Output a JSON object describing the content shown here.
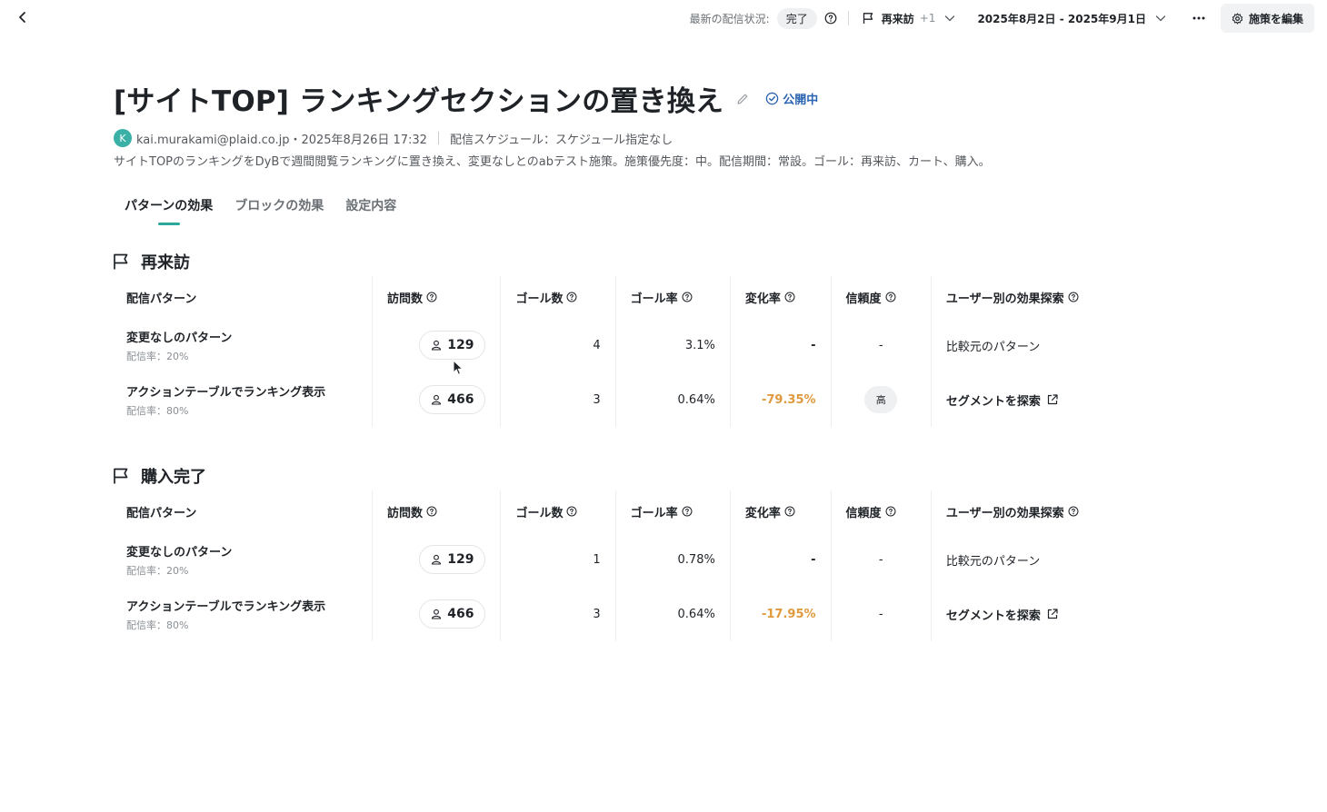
{
  "topbar": {
    "status_label": "最新の配信状況:",
    "status_value": "完了",
    "goal_label": "再来訪",
    "goal_extra": "+1",
    "date_range": "2025年8月2日 - 2025年9月1日",
    "edit_label": "施策を編集"
  },
  "header": {
    "title": "[サイトTOP] ランキングセクションの置き換え",
    "status": "公開中",
    "avatar_initial": "K",
    "author": "kai.murakami@plaid.co.jp・2025年8月26日 17:32",
    "schedule": "配信スケジュール：スケジュール指定なし",
    "description": "サイトTOPのランキングをDyBで週間閲覧ランキングに置き換え、変更なしとのabテスト施策。施策優先度：中。配信期間：常設。ゴール：再来訪、カート、購入。"
  },
  "tabs": [
    {
      "label": "パターンの効果",
      "active": true
    },
    {
      "label": "ブロックの効果",
      "active": false
    },
    {
      "label": "設定内容",
      "active": false
    }
  ],
  "columns": {
    "pattern": "配信パターン",
    "visits": "訪問数",
    "goals": "ゴール数",
    "goal_rate": "ゴール率",
    "change_rate": "変化率",
    "confidence": "信頼度",
    "explore": "ユーザー別の効果探索"
  },
  "sections": [
    {
      "title": "再来訪",
      "rows": [
        {
          "name": "変更なしのパターン",
          "rate": "配信率：20%",
          "visits": "129",
          "goals": "4",
          "goal_rate": "3.1%",
          "change": "-",
          "confidence": "-",
          "explore": "比較元のパターン"
        },
        {
          "name": "アクションテーブルでランキング表示",
          "rate": "配信率：80%",
          "visits": "466",
          "goals": "3",
          "goal_rate": "0.64%",
          "change": "-79.35%",
          "confidence": "高",
          "explore": "セグメントを探索"
        }
      ]
    },
    {
      "title": "購入完了",
      "rows": [
        {
          "name": "変更なしのパターン",
          "rate": "配信率：20%",
          "visits": "129",
          "goals": "1",
          "goal_rate": "0.78%",
          "change": "-",
          "confidence": "-",
          "explore": "比較元のパターン"
        },
        {
          "name": "アクションテーブルでランキング表示",
          "rate": "配信率：80%",
          "visits": "466",
          "goals": "3",
          "goal_rate": "0.64%",
          "change": "-17.95%",
          "confidence": "-",
          "explore": "セグメントを探索"
        }
      ]
    }
  ],
  "colors": {
    "accent": "#2ba89c",
    "status_blue": "#2a63b0",
    "negative": "#e09a3d",
    "avatar": "#3bb0a6"
  }
}
